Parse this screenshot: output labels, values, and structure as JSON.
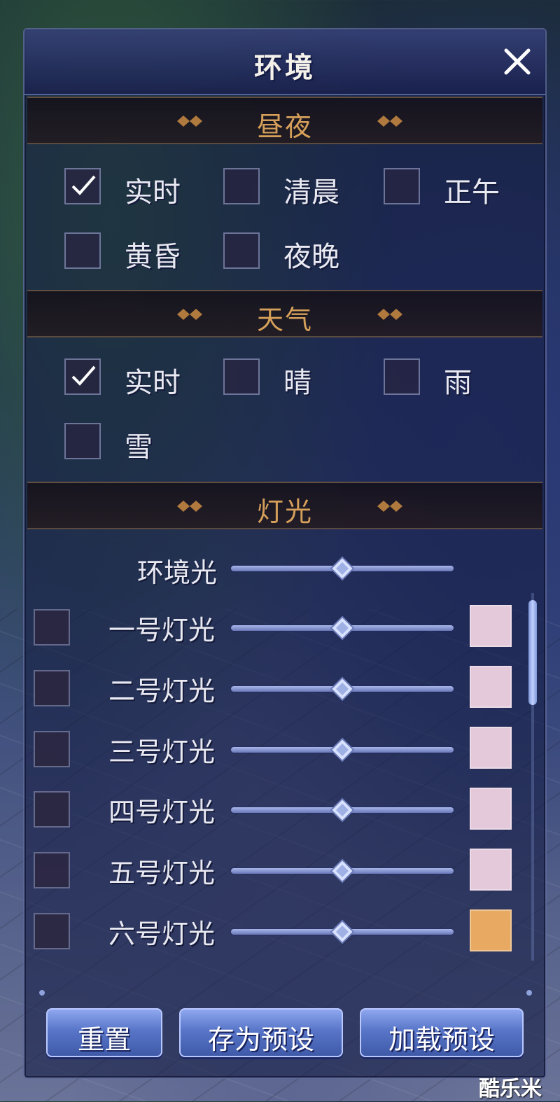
{
  "window": {
    "title": "环境",
    "close_label": "close"
  },
  "sections": {
    "daynight": {
      "title": "昼夜",
      "options": [
        {
          "label": "实时",
          "checked": true
        },
        {
          "label": "清晨",
          "checked": false
        },
        {
          "label": "正午",
          "checked": false
        },
        {
          "label": "黄昏",
          "checked": false
        },
        {
          "label": "夜晚",
          "checked": false
        }
      ]
    },
    "weather": {
      "title": "天气",
      "options": [
        {
          "label": "实时",
          "checked": true
        },
        {
          "label": "晴",
          "checked": false
        },
        {
          "label": "雨",
          "checked": false
        },
        {
          "label": "雪",
          "checked": false
        }
      ]
    },
    "lighting": {
      "title": "灯光",
      "ambient": {
        "label": "环境光",
        "value": 0.5
      },
      "lights": [
        {
          "label": "一号灯光",
          "enabled": false,
          "value": 0.5,
          "color": "#e3c9da"
        },
        {
          "label": "二号灯光",
          "enabled": false,
          "value": 0.5,
          "color": "#e3c9da"
        },
        {
          "label": "三号灯光",
          "enabled": false,
          "value": 0.5,
          "color": "#e3c9da"
        },
        {
          "label": "四号灯光",
          "enabled": false,
          "value": 0.5,
          "color": "#e3c9da"
        },
        {
          "label": "五号灯光",
          "enabled": false,
          "value": 0.5,
          "color": "#e3c9da"
        },
        {
          "label": "六号灯光",
          "enabled": false,
          "value": 0.5,
          "color": "#e8aa62"
        }
      ]
    }
  },
  "buttons": {
    "reset": "重置",
    "save_preset": "存为预设",
    "load_preset": "加载预设"
  },
  "watermark": "酷乐米",
  "colors": {
    "section_title": "#d6a05a",
    "button": "#5875c8",
    "panel": "#161e46"
  }
}
